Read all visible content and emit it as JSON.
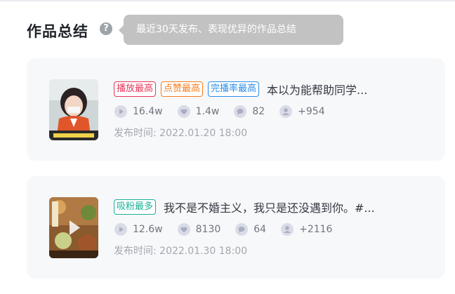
{
  "section": {
    "title": "作品总结",
    "help_icon": "question-icon",
    "tooltip": "最近30天发布、表现优异的作品总结"
  },
  "works": [
    {
      "tags": [
        "播放最高",
        "点赞最高",
        "完播率最高"
      ],
      "title": "本以为能帮助同学...",
      "plays": "16.4w",
      "likes": "1.4w",
      "comments": "82",
      "fans": "+954",
      "time": "发布时间: 2022.01.20 18:00"
    },
    {
      "tags": [
        "吸粉最多"
      ],
      "title": "我不是不婚主义，我只是还没遇到你。#...",
      "plays": "12.6w",
      "likes": "8130",
      "comments": "64",
      "fans": "+2116",
      "time": "发布时间: 2022.01.30 18:00"
    }
  ],
  "colors": {
    "tag_red": "#e8355a",
    "tag_orange": "#f57c1f",
    "tag_blue": "#2a8ee8",
    "tag_teal": "#1bb19a",
    "tooltip_bg": "#c2c2c2",
    "card_bg": "#f7f8fa"
  },
  "icons": {
    "plays": "play-icon",
    "likes": "heart-icon",
    "comments": "comment-icon",
    "fans": "user-icon"
  }
}
